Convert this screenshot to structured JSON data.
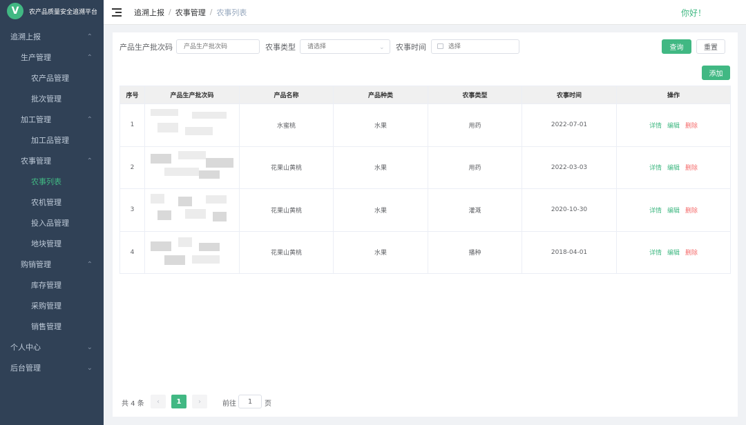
{
  "app": {
    "title": "农产品质量安全追溯平台",
    "logo_letter": "V",
    "accent": "#41b883"
  },
  "sidebar": {
    "items": [
      {
        "label": "追溯上报",
        "level": 1,
        "expanded": true
      },
      {
        "label": "生产管理",
        "level": 2,
        "expanded": true
      },
      {
        "label": "农产品管理",
        "level": 3
      },
      {
        "label": "批次管理",
        "level": 3
      },
      {
        "label": "加工管理",
        "level": 2,
        "expanded": true
      },
      {
        "label": "加工品管理",
        "level": 3
      },
      {
        "label": "农事管理",
        "level": 2,
        "expanded": true
      },
      {
        "label": "农事列表",
        "level": 3,
        "active": true
      },
      {
        "label": "农机管理",
        "level": 3
      },
      {
        "label": "投入品管理",
        "level": 3
      },
      {
        "label": "地块管理",
        "level": 3
      },
      {
        "label": "购销管理",
        "level": 2,
        "expanded": true
      },
      {
        "label": "库存管理",
        "level": 3
      },
      {
        "label": "采购管理",
        "level": 3
      },
      {
        "label": "销售管理",
        "level": 3
      },
      {
        "label": "个人中心",
        "level": 1,
        "expanded": false
      },
      {
        "label": "后台管理",
        "level": 1,
        "expanded": false
      }
    ]
  },
  "header": {
    "breadcrumb": [
      "追溯上报",
      "农事管理",
      "农事列表"
    ],
    "greeting": "你好！"
  },
  "filters": {
    "batch_label": "产品生产批次码",
    "batch_placeholder": "产品生产批次码",
    "type_label": "农事类型",
    "type_placeholder": "请选择",
    "time_label": "农事时间",
    "time_placeholder": "选择",
    "query_label": "查询",
    "reset_label": "重置"
  },
  "toolbar": {
    "add_label": "添加"
  },
  "table": {
    "columns": [
      "序号",
      "产品生产批次码",
      "产品名称",
      "产品种类",
      "农事类型",
      "农事时间",
      "操作"
    ],
    "rows": [
      {
        "index": "1",
        "product": "水蜜桃",
        "category": "水果",
        "type": "用药",
        "time": "2022-07-01"
      },
      {
        "index": "2",
        "product": "花果山黄桃",
        "category": "水果",
        "type": "用药",
        "time": "2022-03-03"
      },
      {
        "index": "3",
        "product": "花果山黄桃",
        "category": "水果",
        "type": "灌溉",
        "time": "2020-10-30"
      },
      {
        "index": "4",
        "product": "花果山黄桃",
        "category": "水果",
        "type": "播种",
        "time": "2018-04-01"
      }
    ],
    "actions": {
      "detail": "详情",
      "edit": "编辑",
      "delete": "删除"
    }
  },
  "pagination": {
    "total_text": "共 4 条",
    "prev": "‹",
    "current_page": "1",
    "next": "›",
    "goto_label": "前往",
    "goto_value": "1",
    "page_suffix": "页"
  }
}
